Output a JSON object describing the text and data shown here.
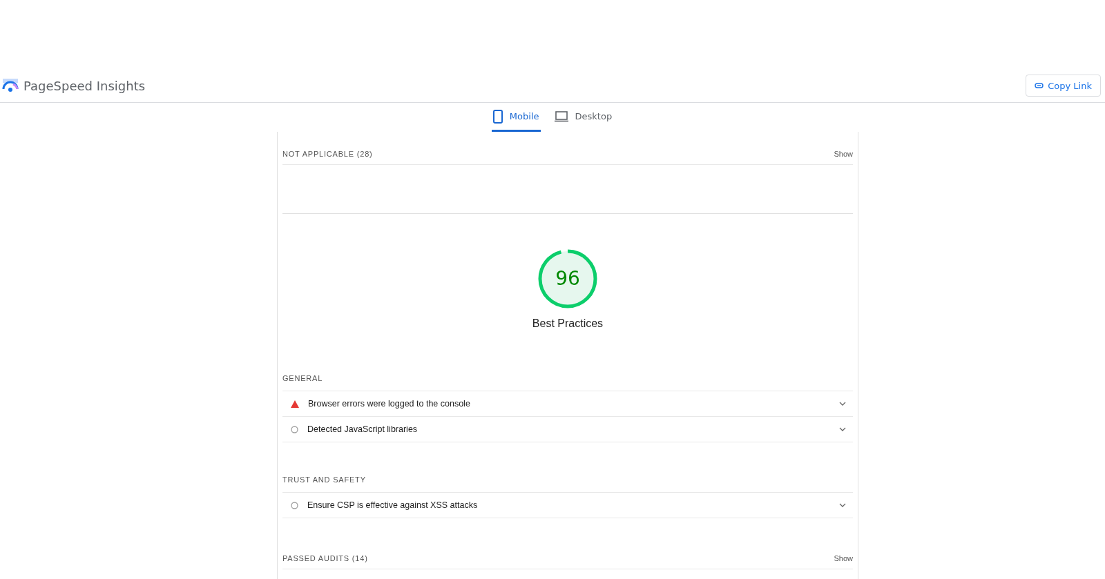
{
  "header": {
    "title": "PageSpeed Insights",
    "copy_button": "Copy Link"
  },
  "tabs": [
    {
      "label": "Mobile",
      "kind": "mobile",
      "selected": true
    },
    {
      "label": "Desktop",
      "kind": "desktop",
      "selected": false
    }
  ],
  "not_applicable": {
    "title": "NOT APPLICABLE",
    "count": "(28)",
    "toggle": "Show"
  },
  "gauge": {
    "score": "96",
    "level": 0.96,
    "label": "Best Practices"
  },
  "groups": [
    {
      "title": "GENERAL",
      "audits": [
        {
          "kind": "fail",
          "text": "Browser errors were logged to the console"
        },
        {
          "kind": "info",
          "text": "Detected JavaScript libraries"
        }
      ]
    },
    {
      "title": "TRUST AND SAFETY",
      "audits": [
        {
          "kind": "info",
          "text": "Ensure CSP is effective against XSS attacks"
        }
      ]
    }
  ],
  "passed": {
    "title": "PASSED AUDITS",
    "count": "(14)",
    "toggle": "Show"
  }
}
